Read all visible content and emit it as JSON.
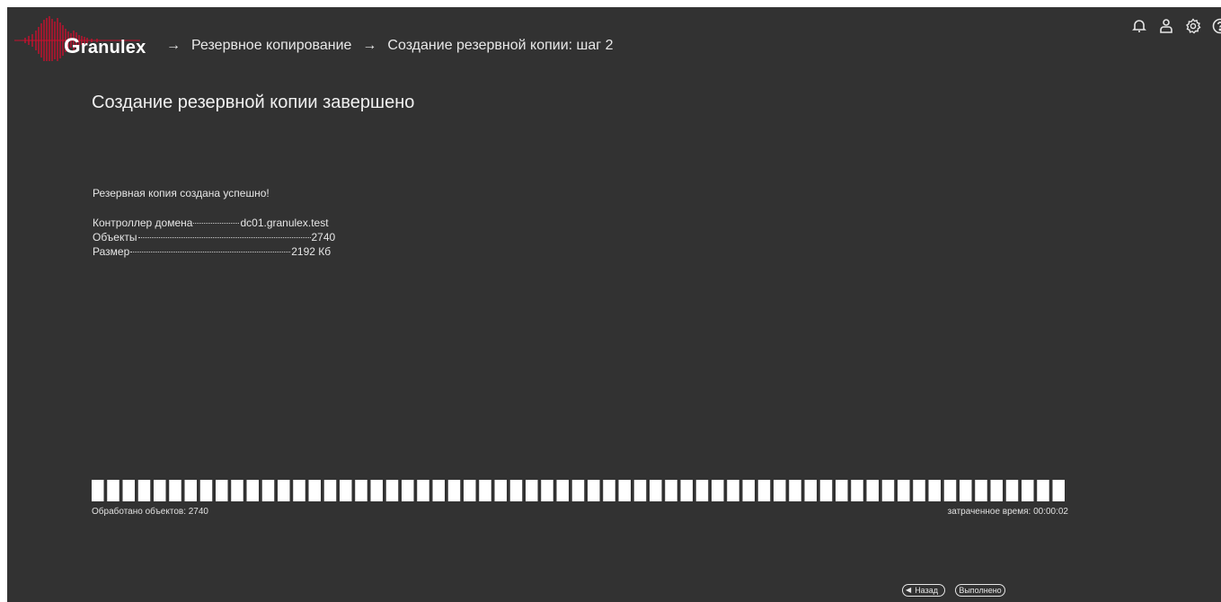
{
  "header": {
    "logo_initial": "G",
    "logo_rest": "ranulex",
    "breadcrumbs": [
      "Резервное копирование",
      "Создание резервной копии: шаг 2"
    ],
    "separator": "→",
    "icons": [
      "bell-icon",
      "user-icon",
      "gear-icon",
      "help-icon"
    ],
    "brand_color": "#c8102e"
  },
  "main": {
    "title": "Создание резервной копии завершено",
    "success_message": "Резервная копия создана успешно!",
    "details": [
      {
        "label": "Контроллер домена",
        "value": "dc01.granulex.test"
      },
      {
        "label": "Объекты",
        "value": "2740"
      },
      {
        "label": "Размер",
        "value": "2192 Кб"
      }
    ]
  },
  "progress": {
    "fraction": 1.0,
    "processed_label": "Обработано объектов: 2740",
    "elapsed_label": "затраченное время: 00:00:02"
  },
  "buttons": {
    "back_label": "Назад",
    "done_label": "Выполнено"
  }
}
